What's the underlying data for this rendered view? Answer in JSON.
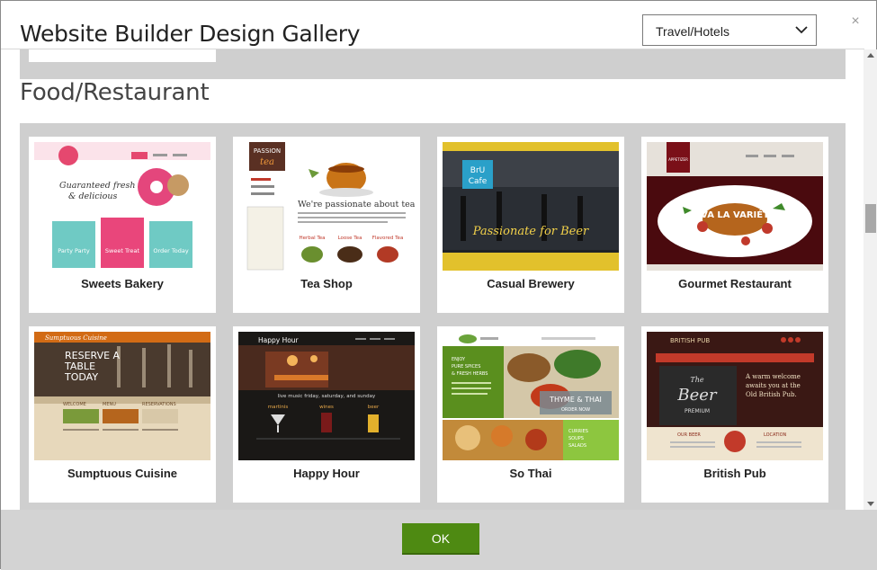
{
  "dialog": {
    "title": "Website Builder Design Gallery",
    "category_select": {
      "value": "Travel/Hotels"
    },
    "close_glyph": "×"
  },
  "section": {
    "title": "Food/Restaurant",
    "templates": [
      {
        "name": "Sweets Bakery"
      },
      {
        "name": "Tea Shop"
      },
      {
        "name": "Casual Brewery"
      },
      {
        "name": "Gourmet Restaurant"
      },
      {
        "name": "Sumptuous Cuisine"
      },
      {
        "name": "Happy Hour"
      },
      {
        "name": "So Thai"
      },
      {
        "name": "British Pub"
      }
    ]
  },
  "thumb_text": {
    "bakery": {
      "tagline1": "Guaranteed fresh",
      "tagline2": "& delicious",
      "tile1": "Party Party",
      "tile2": "Sweet Treat",
      "tile3": "Order Today"
    },
    "tea": {
      "logo1": "PASSION",
      "logo2": "tea",
      "headline": "We're passionate about tea.",
      "item1": "Herbal Tea",
      "item2": "Loose Tea",
      "item3": "Flavored Tea"
    },
    "brewery": {
      "logo1": "BrU",
      "logo2": "Cafe",
      "script": "Passionate for Beer"
    },
    "gourmet": {
      "logo": "APPETIZER",
      "banner": "VIVA LA VARIÉTÉ!"
    },
    "cuisine": {
      "brand": "Sumptuous Cuisine",
      "headline1": "RESERVE A",
      "headline2": "TABLE",
      "headline3": "TODAY",
      "col1": "WELCOME",
      "col2": "MENU",
      "col3": "RESERVATIONS"
    },
    "happy": {
      "title": "Happy Hour",
      "line": "live music friday, saturday, and sunday",
      "col1": "martinis",
      "col2": "wines",
      "col3": "beer"
    },
    "thai": {
      "left1": "ENJOY",
      "left2": "PURE SPICES",
      "left3": "& FRESH HERBS",
      "badge1": "THYME & THAI",
      "badge2": "ORDER NOW",
      "right1": "CURRIES",
      "right2": "SOUPS",
      "right3": "SALADS"
    },
    "pub": {
      "brand": "BRITISH PUB",
      "board1": "The",
      "board2": "Beer",
      "board3": "PREMIUM",
      "welcome1": "A warm welcome",
      "welcome2": "awaits you at the",
      "welcome3": "Old British Pub.",
      "col1": "OUR BEER",
      "col2": "LOCATION"
    }
  },
  "footer": {
    "ok_label": "OK"
  },
  "colors": {
    "accent_green": "#4e8a12",
    "gallery_bg": "#cfcfcf"
  }
}
